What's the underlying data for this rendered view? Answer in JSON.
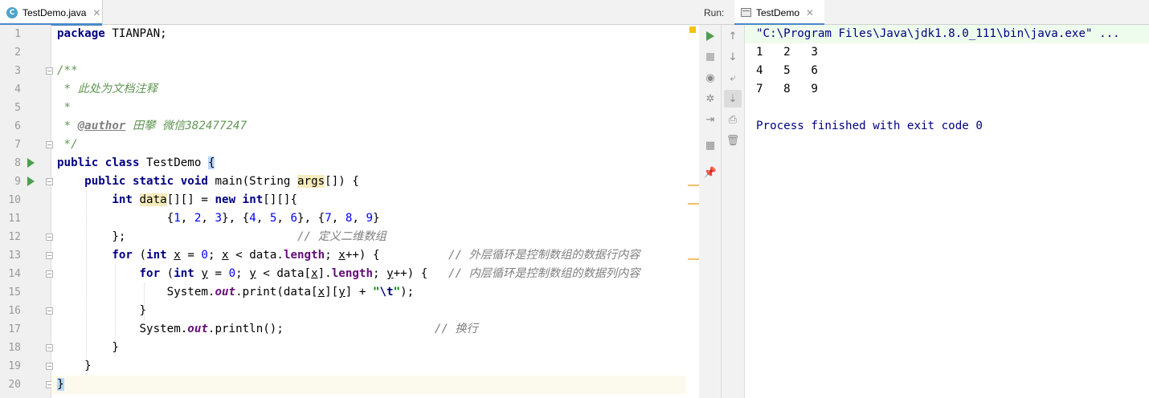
{
  "editor": {
    "tab_label": "TestDemo.java",
    "tab_icon": "C",
    "line_numbers": [
      "1",
      "2",
      "3",
      "4",
      "5",
      "6",
      "7",
      "8",
      "9",
      "10",
      "11",
      "12",
      "13",
      "14",
      "15",
      "16",
      "17",
      "18",
      "19",
      "20"
    ],
    "code": {
      "l1_kw": "package",
      "l1_rest": " TIANPAN;",
      "l3": "/**",
      "l4": " * 此处为文档注释",
      "l5": " *",
      "l6_a": " * ",
      "l6_tag": "@author",
      "l6_b": " 田攀 微信382477247",
      "l7": " */",
      "l8_kw1": "public",
      "l8_kw2": "class",
      "l8_name": " TestDemo ",
      "l8_brace": "{",
      "l9_kw1": "public",
      "l9_kw2": "static",
      "l9_kw3": "void",
      "l9_a": " main(String ",
      "l9_args": "args",
      "l9_b": "[]) {",
      "l10_kw1": "int",
      "l10_var": "data",
      "l10_a": "[][] = ",
      "l10_kw2": "new",
      "l10_kw3": "int",
      "l10_b": "[][]{",
      "l11_a": "{",
      "l11_n1": "1",
      "l11_c1": ", ",
      "l11_n2": "2",
      "l11_c2": ", ",
      "l11_n3": "3",
      "l11_b": "}, {",
      "l11_n4": "4",
      "l11_c4": ", ",
      "l11_n5": "5",
      "l11_c5": ", ",
      "l11_n6": "6",
      "l11_c": "}, {",
      "l11_n7": "7",
      "l11_c7": ", ",
      "l11_n8": "8",
      "l11_c8": ", ",
      "l11_n9": "9",
      "l11_d": "}",
      "l12_a": "};",
      "l12_cmt": "// 定义二维数组",
      "l13_kw1": "for",
      "l13_a": " (",
      "l13_kw2": "int",
      "l13_x1": "x",
      "l13_b": " = ",
      "l13_n": "0",
      "l13_c": "; ",
      "l13_x2": "x",
      "l13_d": " < data.",
      "l13_fld": "length",
      "l13_e": "; ",
      "l13_x3": "x",
      "l13_f": "++) {",
      "l13_cmt": "// 外层循环是控制数组的数据行内容",
      "l14_kw1": "for",
      "l14_a": " (",
      "l14_kw2": "int",
      "l14_y1": "y",
      "l14_b": " = ",
      "l14_n": "0",
      "l14_c": "; ",
      "l14_y2": "y",
      "l14_d": " < data[",
      "l14_x": "x",
      "l14_e": "].",
      "l14_fld": "length",
      "l14_f": "; ",
      "l14_y3": "y",
      "l14_g": "++) {",
      "l14_cmt": "// 内层循环是控制数组的数据列内容",
      "l15_a": "System.",
      "l15_out": "out",
      "l15_b": ".print(data[",
      "l15_x": "x",
      "l15_c": "][",
      "l15_y": "y",
      "l15_d": "] + ",
      "l15_q1": "\"",
      "l15_esc": "\\t",
      "l15_q2": "\"",
      "l15_e": ");",
      "l16": "}",
      "l17_a": "System.",
      "l17_out": "out",
      "l17_b": ".println();",
      "l17_cmt": "// 换行",
      "l18": "}",
      "l19": "}",
      "l20": "}"
    }
  },
  "run": {
    "title": "Run:",
    "tab_label": "TestDemo",
    "output": {
      "command": "\"C:\\Program Files\\Java\\jdk1.8.0_111\\bin\\java.exe\" ...",
      "row1": "1   2   3",
      "row2": "4   5   6",
      "row3": "7   8   9",
      "exit": "Process finished with exit code 0"
    }
  },
  "icons": {
    "close": "✕",
    "up": "↑",
    "down": "↓",
    "wrap": "⤶",
    "scroll_end": "⇣",
    "print": "⎙",
    "trash": "🗑",
    "camera": "◉",
    "settings": "✲",
    "login": "⇥",
    "layout": "▦",
    "pin": "📌"
  },
  "colors": {
    "keyword": "#000080",
    "number": "#0000ff",
    "string": "#008000",
    "comment": "#808080",
    "doc_comment": "#629755",
    "field": "#660e7a",
    "run_green": "#4d9e4d",
    "tab_underline": "#4a88c7"
  }
}
